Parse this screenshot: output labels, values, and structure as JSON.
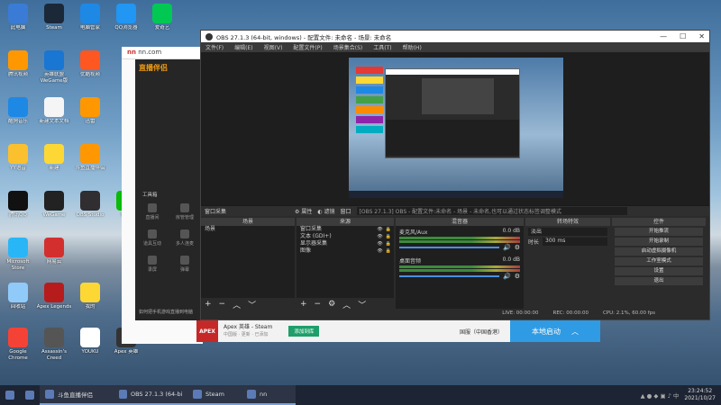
{
  "desktop_icons": [
    {
      "label": "此电脑",
      "icon": "computer-icon",
      "color": "#3a7bd5"
    },
    {
      "label": "Steam",
      "icon": "steam-icon",
      "color": "#1b2838"
    },
    {
      "label": "电脑管家",
      "icon": "shield-icon",
      "color": "#1e88e5"
    },
    {
      "label": "QQ浏览器",
      "icon": "browser-icon",
      "color": "#2196f3"
    },
    {
      "label": "爱奇艺",
      "icon": "iqiyi-icon",
      "color": "#00c853"
    },
    {
      "label": "腾讯视频",
      "icon": "video-icon",
      "color": "#ff9800"
    },
    {
      "label": "英雄联盟WeGame版",
      "icon": "wegame-icon",
      "color": "#1976d2"
    },
    {
      "label": "优酷视频",
      "icon": "youku-icon",
      "color": "#ff5722"
    },
    {
      "label": "酷狗音乐",
      "icon": "kugou-icon",
      "color": "#1e88e5"
    },
    {
      "label": "新建文本文档",
      "icon": "text-file-icon",
      "color": "#f5f5f5"
    },
    {
      "label": "迅雷",
      "icon": "thunder-icon",
      "color": "#ff9800"
    },
    {
      "label": "YY语音",
      "icon": "yy-icon",
      "color": "#fbc02d"
    },
    {
      "label": "新建",
      "icon": "folder-icon",
      "color": "#fdd835"
    },
    {
      "label": "斗鱼直播伴侣",
      "icon": "douyu-icon",
      "color": "#ff9800"
    },
    {
      "label": "腾讯QQ",
      "icon": "qq-icon",
      "color": "#111111"
    },
    {
      "label": "WeGame",
      "icon": "wegame-icon",
      "color": "#222222"
    },
    {
      "label": "OBS Studio",
      "icon": "obs-icon",
      "color": "#302e31"
    },
    {
      "label": "微信",
      "icon": "wechat-icon",
      "color": "#09bb07"
    },
    {
      "label": "Microsoft Store",
      "icon": "store-icon",
      "color": "#29b6f6"
    },
    {
      "label": "网易云",
      "icon": "netease-icon",
      "color": "#d32f2f"
    },
    {
      "label": "回收站",
      "icon": "recycle-icon",
      "color": "#90caf9"
    },
    {
      "label": "Apex Legends",
      "icon": "apex-icon",
      "color": "#b71c1c"
    },
    {
      "label": "我的",
      "icon": "folder-icon",
      "color": "#fdd835"
    },
    {
      "label": "Google Chrome",
      "icon": "chrome-icon",
      "color": "#f44336"
    },
    {
      "label": "Assassin's Creed",
      "icon": "game-icon",
      "color": "#555555"
    },
    {
      "label": "YOUKU",
      "icon": "youku-icon",
      "color": "#ffffff"
    },
    {
      "label": "Apex 英雄",
      "icon": "apex-icon",
      "color": "#333333"
    }
  ],
  "douyu": {
    "url": "nn.com",
    "logo": "直播伴侣",
    "side_label": "工具箱",
    "tools": [
      "直播间",
      "房管管理",
      "道具互动",
      "多人连麦",
      "录屏",
      "弹幕"
    ],
    "bottom_text": "如何把手机游戏直播到电脑"
  },
  "obs": {
    "title": "OBS 27.1.3 (64-bit, windows) - 配置文件: 未命名 - 场景: 未命名",
    "menu": [
      "文件(F)",
      "编辑(E)",
      "视图(V)",
      "配置文件(P)",
      "场景集合(S)",
      "工具(T)",
      "帮助(H)"
    ],
    "source_bar": [
      "窗口采集",
      "属性",
      "滤镜",
      "窗口"
    ],
    "source_bar_info": "[OBS 27.1.3] OBS - 配置文件:未命名 - 场景 - 未命名,也可以通过状态标签调整模式",
    "docks": {
      "scenes": {
        "title": "场景",
        "items": [
          "场景"
        ]
      },
      "sources": {
        "title": "来源",
        "items": [
          "窗口采集",
          "文本 (GDI+)",
          "显示器采集",
          "图像"
        ]
      },
      "mixer": {
        "title": "混音器",
        "channels": [
          {
            "name": "麦克风/Aux",
            "db": "0.0 dB"
          },
          {
            "name": "桌面音频",
            "db": "0.0 dB"
          }
        ]
      },
      "transitions": {
        "title": "转场特效",
        "type": "淡出",
        "duration_label": "时长",
        "duration": "300 ms"
      },
      "controls": {
        "title": "控件",
        "buttons": [
          "开始推流",
          "开始录制",
          "启动虚拟摄像机",
          "工作室模式",
          "设置",
          "退出"
        ]
      }
    },
    "status": {
      "live": "LIVE: 00:00:00",
      "rec": "REC: 00:00:00",
      "cpu": "CPU: 2.1%, 60.00 fps"
    }
  },
  "steam_bar": {
    "game": "Apex 英雄 - Steam",
    "sub": "中国版 · 更新 · 已添加",
    "btn": "添加到库",
    "region": "国服（中国香港）",
    "launch": "本地启动"
  },
  "taskbar": {
    "items": [
      {
        "label": "",
        "icon": "windows-icon"
      },
      {
        "label": "",
        "icon": "chrome-icon"
      },
      {
        "label": "斗鱼直播伴侣",
        "icon": "douyu-icon"
      },
      {
        "label": "OBS 27.1.3 (64-bi...",
        "icon": "obs-icon"
      },
      {
        "label": "Steam",
        "icon": "steam-icon"
      },
      {
        "label": "nn",
        "icon": "nn-icon"
      }
    ],
    "time": "23:24:52",
    "date": "2021/10/27"
  }
}
